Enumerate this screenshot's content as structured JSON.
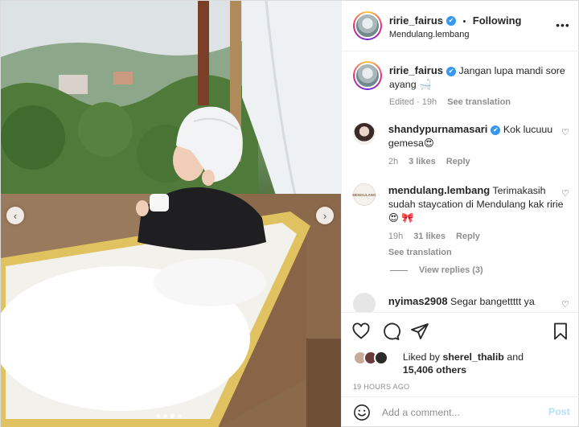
{
  "photo": {
    "alt_icons": {
      "prev": "chevron-left-icon",
      "next": "chevron-right-icon"
    },
    "carousel": {
      "count": 4,
      "active_index": 2
    }
  },
  "header": {
    "username": "ririe_fairus",
    "separator": "•",
    "follow_label": "Following",
    "location": "Mendulang.lembang",
    "more_icon": "more-horizontal-icon"
  },
  "caption": {
    "username": "ririe_fairus",
    "text": "Jangan lupa mandi sore ayang 🛁",
    "time": "Edited · 19h",
    "see_translation": "See translation"
  },
  "comments": [
    {
      "username": "shandypurnamasari",
      "verified": true,
      "text": "Kok lucuuu gemesa😍",
      "time": "2h",
      "likes": "3 likes",
      "reply": "Reply"
    },
    {
      "username": "mendulang.lembang",
      "avatar_label": "MENDULANG",
      "verified": false,
      "text": "Terimakasih sudah staycation di Mendulang kak ririe😍 🎀",
      "time": "19h",
      "likes": "31 likes",
      "reply": "Reply",
      "see_translation": "See translation",
      "view_replies": "View replies (3)"
    },
    {
      "username": "nyimas2908",
      "verified": false,
      "text": "Segar bangettttt ya"
    }
  ],
  "actions": {
    "like_icon": "heart-icon",
    "comment_icon": "comment-icon",
    "share_icon": "send-icon",
    "save_icon": "bookmark-icon"
  },
  "likes": {
    "prefix": "Liked by",
    "user": "sherel_thalib",
    "and": "and",
    "others": "15,406 others"
  },
  "timestamp": "19 HOURS AGO",
  "add_comment": {
    "placeholder": "Add a comment...",
    "post_label": "Post"
  },
  "colors": {
    "verified_blue": "#3897f0",
    "post_button": "#b2dffc",
    "meta_gray": "#8e8e8e"
  }
}
